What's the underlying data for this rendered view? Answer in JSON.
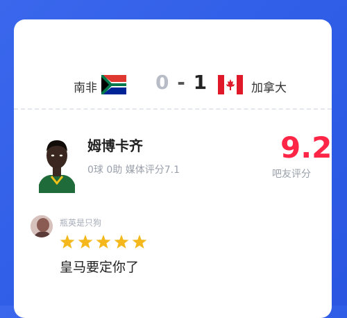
{
  "match": {
    "home_team": "南非",
    "home_score": "0",
    "separator": "-",
    "away_score": "1",
    "away_team": "加拿大"
  },
  "player": {
    "name": "姆博卡齐",
    "stats": "0球 0助 媒体评分7.1",
    "rating": "9.2",
    "rating_label": "吧友评分"
  },
  "comment": {
    "username": "瓶英是只狗",
    "stars": 5,
    "text": "皇马要定你了"
  },
  "colors": {
    "background_blue": "#2f5de6",
    "rating_red": "#ff2547",
    "star_gold": "#f5b81c"
  }
}
